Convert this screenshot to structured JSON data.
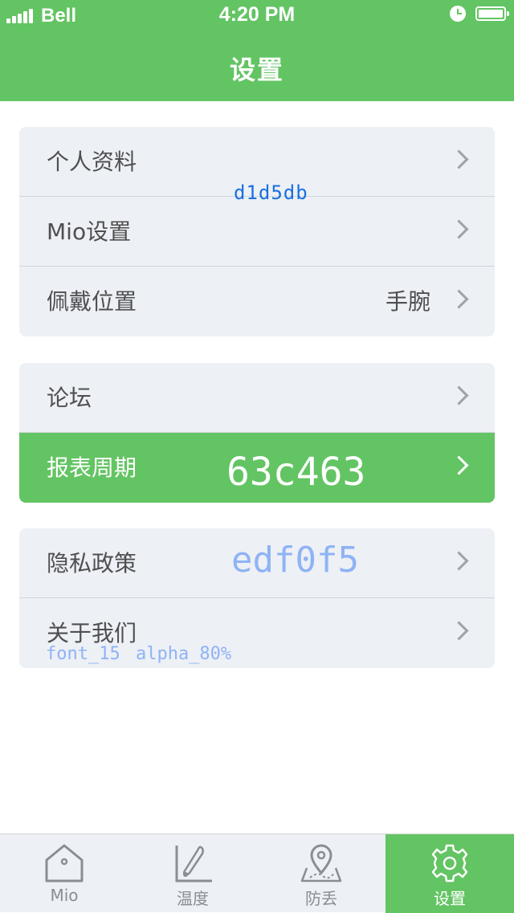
{
  "status_bar": {
    "carrier": "Bell",
    "time": "4:20 PM"
  },
  "nav": {
    "title": "设置"
  },
  "groups": [
    {
      "rows": [
        {
          "label": "个人资料",
          "value": ""
        },
        {
          "label": "Mio设置",
          "value": ""
        },
        {
          "label": "佩戴位置",
          "value": "手腕"
        }
      ]
    },
    {
      "rows": [
        {
          "label": "论坛",
          "value": ""
        },
        {
          "label": "报表周期",
          "value": "",
          "active": true
        }
      ]
    },
    {
      "rows": [
        {
          "label": "隐私政策",
          "value": ""
        },
        {
          "label": "关于我们",
          "value": ""
        }
      ]
    }
  ],
  "annotations": {
    "divider_color": "d1d5db",
    "accent_color": "63c463",
    "row_bg_color": "edf0f5",
    "font_note": "font_15  alpha_80%"
  },
  "tabs": [
    {
      "label": "Mio",
      "icon": "house-icon"
    },
    {
      "label": "温度",
      "icon": "thermometer-icon"
    },
    {
      "label": "防丢",
      "icon": "map-pin-icon"
    },
    {
      "label": "设置",
      "icon": "gear-icon",
      "active": true
    }
  ],
  "colors": {
    "accent": "#63c463",
    "row_bg": "#edf0f5",
    "divider": "#d1d5db",
    "chevron": "#9ea3a9"
  }
}
